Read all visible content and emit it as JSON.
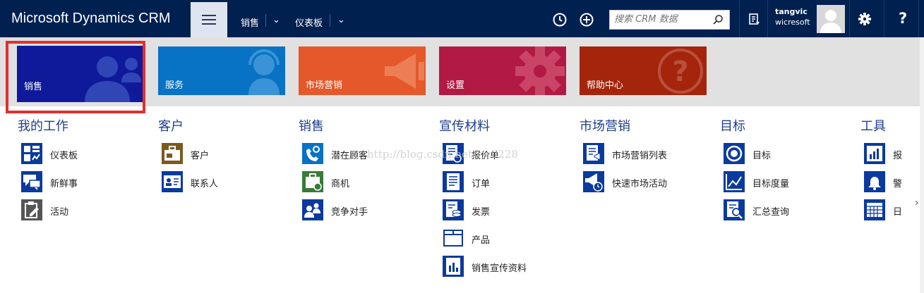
{
  "header": {
    "brand": "Microsoft Dynamics CRM",
    "nav": [
      {
        "label": "销售"
      },
      {
        "label": "仪表板"
      }
    ],
    "search_placeholder": "搜索 CRM 数据",
    "user_name": "tangvic",
    "user_org": "wicresoft",
    "help_label": "?"
  },
  "tiles": [
    {
      "label": "销售",
      "color": "#0f1a9a"
    },
    {
      "label": "服务",
      "color": "#0872c4"
    },
    {
      "label": "市场营销",
      "color": "#e4582b"
    },
    {
      "label": "设置",
      "color": "#b21a43"
    },
    {
      "label": "帮助中心",
      "color": "#a4250c"
    }
  ],
  "columns": [
    {
      "title": "我的工作",
      "items": [
        "仪表板",
        "新鲜事",
        "活动"
      ]
    },
    {
      "title": "客户",
      "items": [
        "客户",
        "联系人"
      ]
    },
    {
      "title": "销售",
      "items": [
        "潜在顾客",
        "商机",
        "竞争对手"
      ]
    },
    {
      "title": "宣传材料",
      "items": [
        "报价单",
        "订单",
        "发票",
        "产品",
        "销售宣传资料"
      ]
    },
    {
      "title": "市场营销",
      "items": [
        "市场营销列表",
        "快速市场活动"
      ]
    },
    {
      "title": "目标",
      "items": [
        "目标",
        "目标度量",
        "汇总查询"
      ]
    },
    {
      "title": "工具",
      "items": [
        "报",
        "警",
        "日"
      ]
    }
  ],
  "watermark": "http://blog.csdn.net/vic0228",
  "colors": {
    "header_bg": "#002050",
    "heading": "#1e3f8c",
    "icon_blue": "#0a3a9e"
  }
}
